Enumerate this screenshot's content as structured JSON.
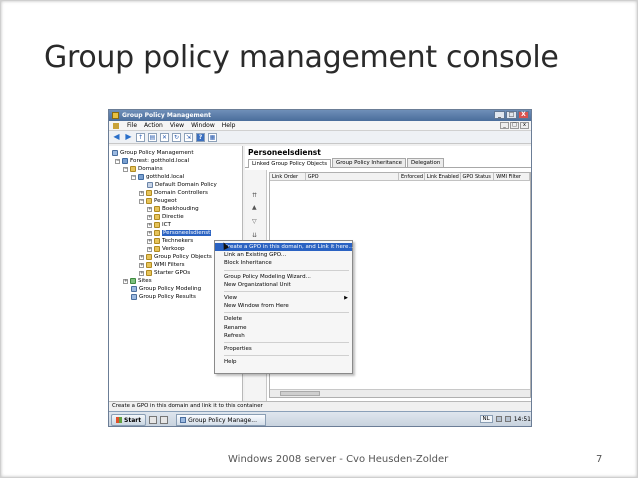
{
  "slide": {
    "title": "Group policy management console",
    "footer": "Windows 2008 server - Cvo Heusden-Zolder",
    "number": "7"
  },
  "window": {
    "title": "Group Policy Management",
    "controls": [
      "_",
      "□",
      "X"
    ],
    "menu": [
      "File",
      "Action",
      "View",
      "Window",
      "Help"
    ]
  },
  "tree": {
    "items": [
      {
        "label": "Group Policy Management"
      },
      {
        "label": "Forest: gotthold.local"
      },
      {
        "label": "Domains"
      },
      {
        "label": "gotthold.local"
      },
      {
        "label": "Default Domain Policy"
      },
      {
        "label": "Domain Controllers"
      },
      {
        "label": "Peugeot"
      },
      {
        "label": "Boekhouding"
      },
      {
        "label": "Directie"
      },
      {
        "label": "ICT"
      },
      {
        "label": "Personeelsdienst"
      },
      {
        "label": "Technekers"
      },
      {
        "label": "Verkoop"
      },
      {
        "label": "Group Policy Objects"
      },
      {
        "label": "WMI Filters"
      },
      {
        "label": "Starter GPOs"
      },
      {
        "label": "Sites"
      },
      {
        "label": "Group Policy Modeling"
      },
      {
        "label": "Group Policy Results"
      }
    ]
  },
  "right_pane": {
    "title": "Personeelsdienst",
    "tabs": [
      "Linked Group Policy Objects",
      "Group Policy Inheritance",
      "Delegation"
    ],
    "columns": [
      "Link Order",
      "GPO",
      "Enforced",
      "Link Enabled",
      "GPO Status",
      "WMI Filter"
    ]
  },
  "context_menu": {
    "items": [
      "Create a GPO in this domain, and Link it here...",
      "Link an Existing GPO...",
      "Block Inheritance",
      "Group Policy Modeling Wizard...",
      "New Organizational Unit",
      "View",
      "New Window from Here",
      "Delete",
      "Rename",
      "Refresh",
      "Properties",
      "Help"
    ]
  },
  "statusbar": {
    "text": "Create a GPO in this domain and link it to this container"
  },
  "taskbar": {
    "start": "Start",
    "task": "Group Policy Manage...",
    "lang": "NL",
    "clock": "14:51"
  }
}
